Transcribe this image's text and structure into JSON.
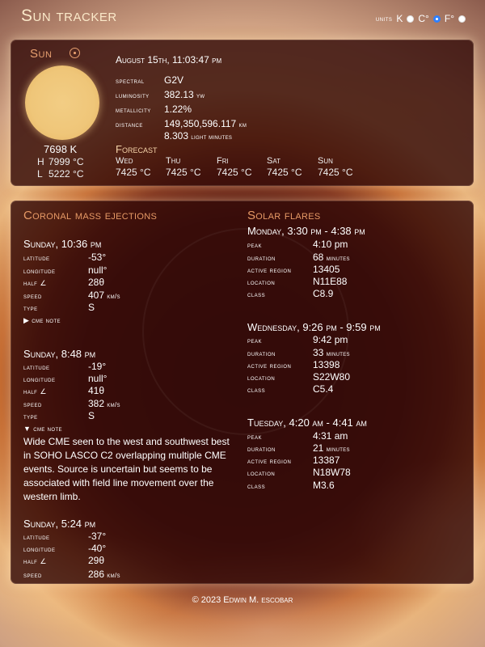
{
  "header": {
    "title": "Sun tracker",
    "units_label": "units",
    "unit_options": [
      {
        "label": "K",
        "selected": false
      },
      {
        "label": "C°",
        "selected": true
      },
      {
        "label": "F°",
        "selected": false
      }
    ]
  },
  "sun": {
    "name": "Sun",
    "temperature": "7698 K",
    "high_label": "H",
    "high": "7999 °C",
    "low_label": "L",
    "low": "5222 °C",
    "datetime": "August 15th, 11:03:47 pm",
    "spectral_label": "spectral",
    "spectral": "G2V",
    "luminosity_label": "luminosity",
    "luminosity": "382.13",
    "luminosity_unit": "yw",
    "metallicity_label": "metallicity",
    "metallicity": "1.22%",
    "distance_label": "distance",
    "distance": "149,350,596.117",
    "distance_unit": "km",
    "distance_light": "8.303",
    "distance_light_unit": "light minutes",
    "forecast_title": "Forecast",
    "forecast": [
      {
        "day": "Wed",
        "value": "7425 °C"
      },
      {
        "day": "Thu",
        "value": "7425 °C"
      },
      {
        "day": "Fri",
        "value": "7425 °C"
      },
      {
        "day": "Sat",
        "value": "7425 °C"
      },
      {
        "day": "Sun",
        "value": "7425 °C"
      }
    ]
  },
  "cme": {
    "title": "Coronal mass ejections",
    "labels": {
      "latitude": "latitude",
      "longitude": "longitude",
      "half": "half ∠",
      "speed": "speed",
      "type": "type",
      "speed_unit": "km/s",
      "note": "cme note"
    },
    "events": [
      {
        "time": "Sunday, 10:36 pm",
        "latitude": "-53°",
        "longitude": "null°",
        "half": "28θ",
        "speed": "407",
        "type": "S",
        "note_open": false
      },
      {
        "time": "Sunday, 8:48 pm",
        "latitude": "-19°",
        "longitude": "null°",
        "half": "41θ",
        "speed": "382",
        "type": "S",
        "note_open": true,
        "note": "Wide CME seen to the west and southwest best in SOHO LASCO C2 overlapping multiple CME events. Source is uncertain but seems to be associated with field line movement over the western limb."
      },
      {
        "time": "Sunday, 5:24 pm",
        "latitude": "-37°",
        "longitude": "-40°",
        "half": "29θ",
        "speed": "286"
      }
    ]
  },
  "flares": {
    "title": "Solar flares",
    "labels": {
      "peak": "peak",
      "duration": "duration",
      "active_region": "active region",
      "location": "location",
      "class": "class",
      "minutes": "minutes"
    },
    "events": [
      {
        "time": "Monday, 3:30 pm - 4:38 pm",
        "peak": "4:10 pm",
        "duration": "68",
        "active_region": "13405",
        "location": "N11E88",
        "class": "C8.9"
      },
      {
        "time": "Wednesday, 9:26 pm - 9:59 pm",
        "peak": "9:42 pm",
        "duration": "33",
        "active_region": "13398",
        "location": "S22W80",
        "class": "C5.4"
      },
      {
        "time": "Tuesday, 4:20 am - 4:41 am",
        "peak": "4:31 am",
        "duration": "21",
        "active_region": "13387",
        "location": "N18W78",
        "class": "M3.6"
      }
    ]
  },
  "footer": {
    "text": "© 2023 Edwin M. escobar"
  }
}
